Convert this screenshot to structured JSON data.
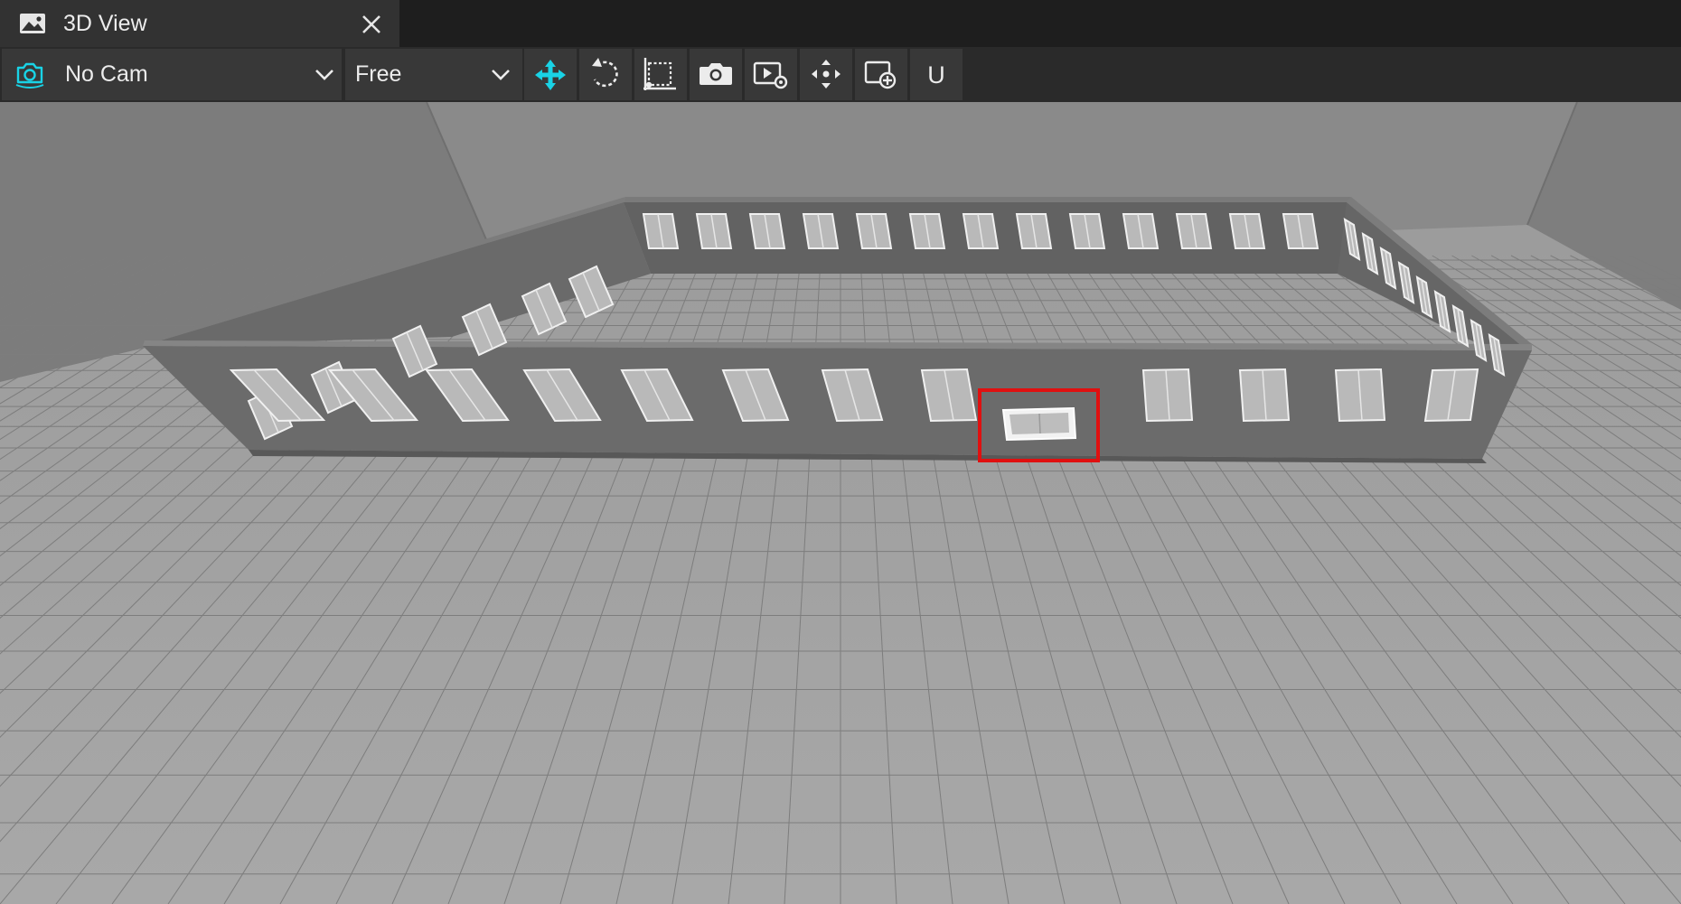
{
  "window": {
    "tab_title": "3D View",
    "tab_icon": "image-icon",
    "close_icon": "close-icon"
  },
  "toolbar": {
    "camera_select": {
      "icon": "camera-icon",
      "value": "No Cam"
    },
    "mode_select": {
      "value": "Free"
    },
    "buttons": [
      {
        "name": "move-tool-button",
        "icon": "move-arrows-icon",
        "active": true
      },
      {
        "name": "rotate-tool-button",
        "icon": "rotate-icon"
      },
      {
        "name": "scale-tool-button",
        "icon": "scale-icon"
      },
      {
        "name": "screenshot-button",
        "icon": "camera-icon"
      },
      {
        "name": "render-settings-button",
        "icon": "render-settings-icon"
      },
      {
        "name": "pan-button",
        "icon": "pan-arrows-icon"
      },
      {
        "name": "add-view-button",
        "icon": "add-view-icon"
      },
      {
        "name": "u-button",
        "label": "U"
      }
    ]
  },
  "colors": {
    "accent": "#19d3e6",
    "highlight": "#e01010",
    "tab_bg": "#323232",
    "toolbar_btn_bg": "#383838"
  }
}
